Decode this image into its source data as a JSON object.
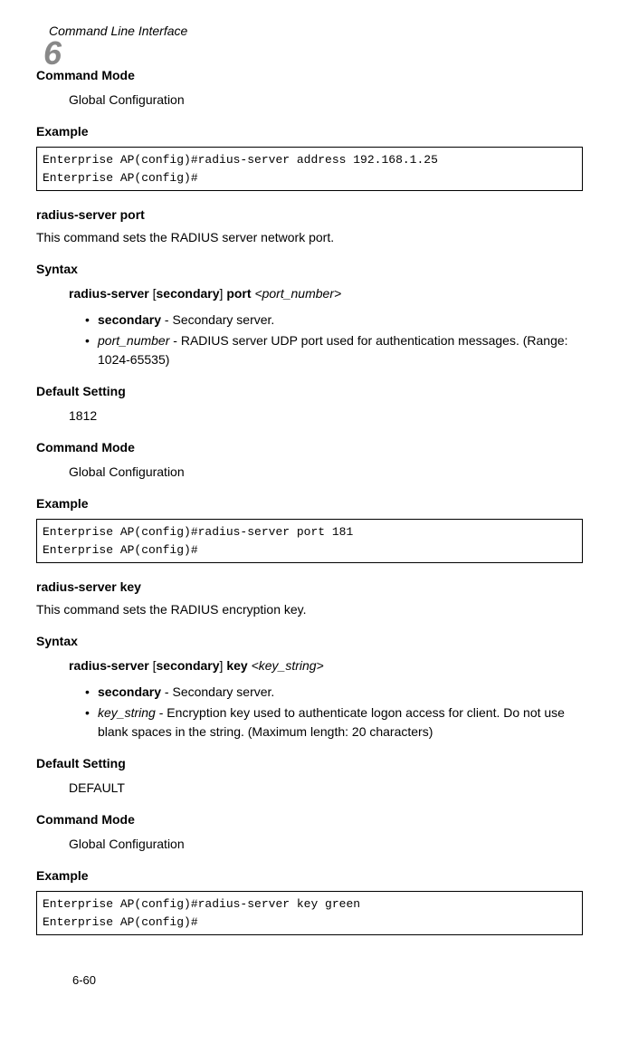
{
  "chapter": {
    "number": "6",
    "title": "Command Line Interface"
  },
  "sections": {
    "command_mode_label": "Command Mode",
    "global_config": "Global Configuration",
    "example_label": "Example",
    "syntax_label": "Syntax",
    "default_setting_label": "Default Setting"
  },
  "block1": {
    "code": "Enterprise AP(config)#radius-server address 192.168.1.25\nEnterprise AP(config)#"
  },
  "radius_port": {
    "title": "radius-server port",
    "desc": "This command sets the RADIUS server network port.",
    "syntax_cmd1": "radius-server",
    "syntax_opt": "secondary",
    "syntax_cmd2": "port",
    "syntax_arg": "<port_number>",
    "bullet1_bold": "secondary",
    "bullet1_rest": " - Secondary server.",
    "bullet2_italic": "port_number",
    "bullet2_rest": " - RADIUS server UDP port used for authentication messages. (Range: 1024-65535)",
    "default_value": "1812",
    "code": "Enterprise AP(config)#radius-server port 181\nEnterprise AP(config)#"
  },
  "radius_key": {
    "title": "radius-server key",
    "desc": "This command sets the RADIUS encryption key.",
    "syntax_cmd1": "radius-server",
    "syntax_opt": "secondary",
    "syntax_cmd2": "key",
    "syntax_arg": "<key_string>",
    "bullet1_bold": "secondary",
    "bullet1_rest": " - Secondary server.",
    "bullet2_italic": "key_string",
    "bullet2_rest": " - Encryption key used to authenticate logon access for client. Do not use blank spaces in the string. (Maximum length: 20 characters)",
    "default_value": "DEFAULT",
    "code": "Enterprise AP(config)#radius-server key green\nEnterprise AP(config)#"
  },
  "page_number": "6-60"
}
